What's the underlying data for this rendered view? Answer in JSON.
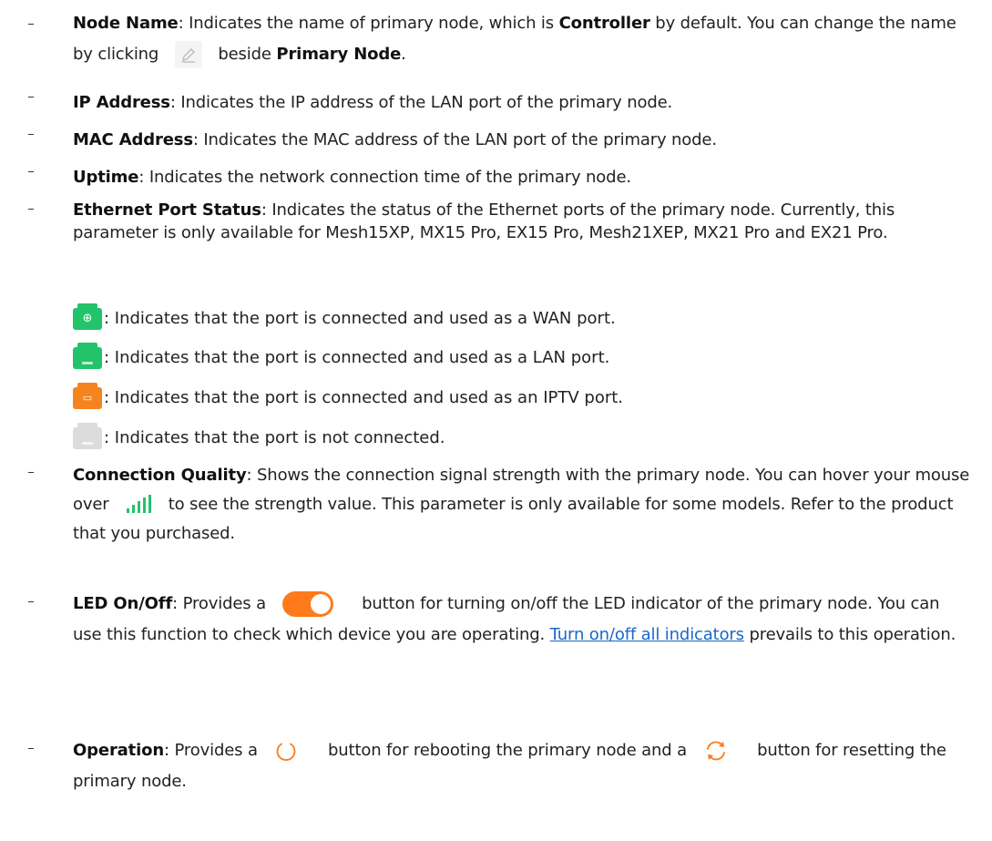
{
  "items": {
    "node_name": {
      "title": "Node Name",
      "t1": ": Indicates the name of primary node, which is ",
      "bold2": "Controller",
      "t2": " by default. You can change the name by clicking ",
      "t3": " beside ",
      "bold3": "Primary Node",
      "t4": "."
    },
    "ip": {
      "title": "IP Address",
      "text": ": Indicates the IP address of the LAN port of the primary node."
    },
    "mac": {
      "title": "MAC Address",
      "text": ": Indicates the MAC address of the LAN port of the primary node."
    },
    "uptime": {
      "title": "Uptime",
      "text": ": Indicates the network connection time of the primary node."
    },
    "eth": {
      "title": "Ethernet Port Status",
      "text": ": Indicates the status of the Ethernet ports of the primary node. Currently, this parameter is only available for Mesh15XP, MX15 Pro, EX15 Pro, Mesh21XEP, MX21 Pro and EX21 Pro.",
      "ports": [
        {
          "icon": "wan-port-icon",
          "color": "#22c36a",
          "text": ": Indicates that the port is connected and used as a WAN port."
        },
        {
          "icon": "lan-port-icon",
          "color": "#22c36a",
          "text": ": Indicates that the port is connected and used as a LAN port."
        },
        {
          "icon": "iptv-port-icon",
          "color": "#f5841f",
          "text": ": Indicates that the port is connected and used as an IPTV port."
        },
        {
          "icon": "disconnected-port-icon",
          "color": "#dcdcdc",
          "text": ": Indicates that the port is not connected."
        }
      ]
    },
    "conn": {
      "title": "Connection Quality",
      "t1": ": Shows the connection signal strength with the primary node. You can hover your mouse over ",
      "t2": " to see the strength value. This parameter is only available for some models. Refer to the product that you purchased."
    },
    "led": {
      "title": "LED On/Off",
      "t1": ": Provides a ",
      "t2": " button for turning on/off the LED indicator of the primary node. You can use this function to check which device you are operating. ",
      "link": "Turn on/off all indicators",
      "t3": " prevails to this operation."
    },
    "op": {
      "title": "Operation",
      "t1": ": Provides a ",
      "t2": " button for rebooting the primary node and a ",
      "t3": " button for resetting the primary node."
    }
  },
  "colors": {
    "accent_orange": "#ff7a1a",
    "signal_green": "#22c36a",
    "link_blue": "#1a66cc"
  }
}
